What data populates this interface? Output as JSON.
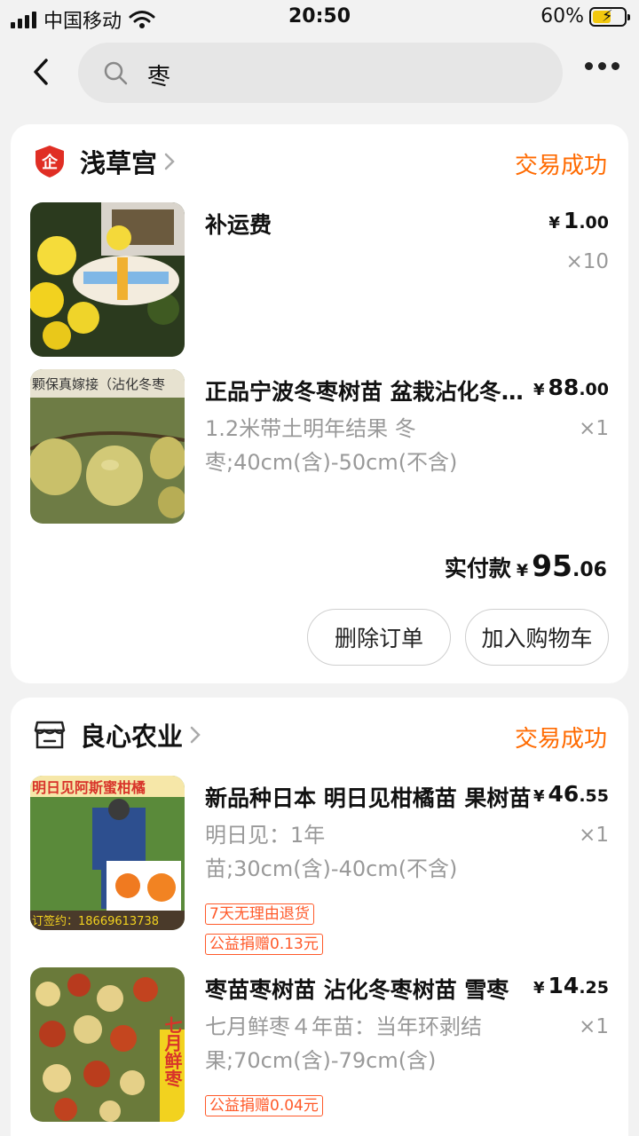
{
  "status_bar": {
    "carrier": "中国移动",
    "time": "20:50",
    "battery": "60%",
    "battery_level": 0.6
  },
  "search": {
    "query": "枣"
  },
  "orders": [
    {
      "shop": "浅草宫",
      "status": "交易成功",
      "items": [
        {
          "title": "补运费",
          "sku": "",
          "price_int": "1",
          "price_dec": ".00",
          "qty": "×10"
        },
        {
          "title": "正品宁波冬枣树苗 盆栽沾化冬枣苗南北方种植",
          "sku": "1.2米带土明年结果 冬枣;40cm(含)-50cm(不含)",
          "price_int": "88",
          "price_dec": ".00",
          "qty": "×1",
          "image_text": "颗保真嫁接（沾化冬枣"
        }
      ],
      "total_label": "实付款",
      "total_int": "95",
      "total_dec": ".06",
      "actions": [
        "删除订单",
        "加入购物车"
      ]
    },
    {
      "shop": "良心农业",
      "status": "交易成功",
      "items": [
        {
          "title": "新品种日本 明日见柑橘苗 果树苗",
          "sku": "明日见：1年苗;30cm(含)-40cm(不含)",
          "price_int": "46",
          "price_dec": ".55",
          "qty": "×1",
          "tags": [
            "7天无理由退货",
            "公益捐赠0.13元"
          ],
          "image_top_text": "明日见阿斯蜜柑橘",
          "image_bottom_text": "订签约：18669613738"
        },
        {
          "title": "枣苗枣树苗 沾化冬枣树苗 雪枣",
          "sku": "七月鲜枣４年苗：当年环剥结果;70cm(含)-79cm(含)",
          "price_int": "14",
          "price_dec": ".25",
          "qty": "×1",
          "tags": [
            "公益捐赠0.04元"
          ],
          "image_text": "七月鲜枣"
        }
      ]
    }
  ],
  "currency": "¥",
  "colors": {
    "accent": "#ff6a00",
    "tag": "#ff5a2a",
    "muted": "#999999"
  }
}
